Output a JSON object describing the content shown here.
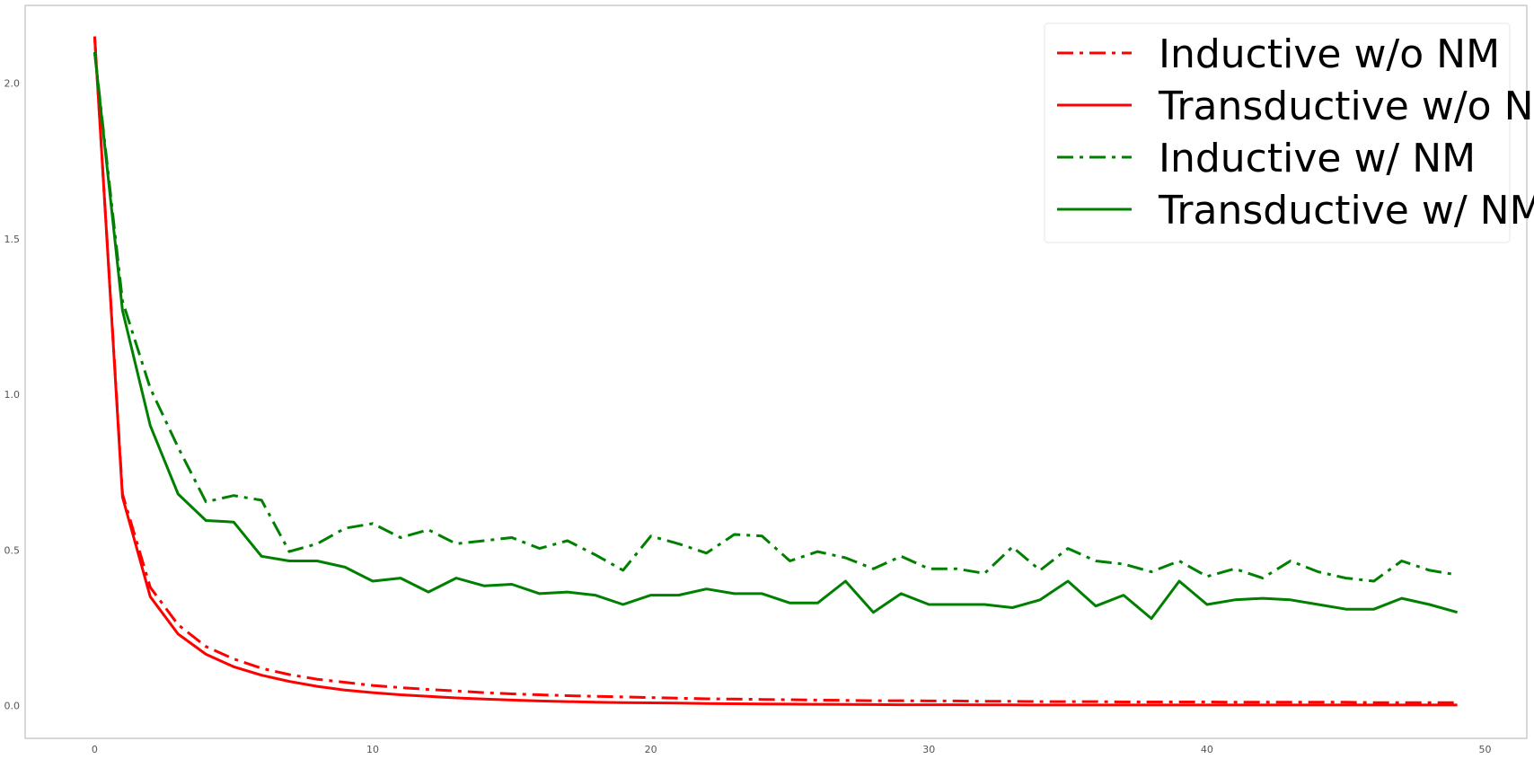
{
  "chart_data": {
    "type": "line",
    "title": "",
    "xlabel": "",
    "ylabel": "",
    "xlim": [
      -2.5,
      51.5
    ],
    "ylim": [
      -0.105,
      2.25
    ],
    "x_ticks": [
      0,
      10,
      20,
      30,
      40,
      50
    ],
    "y_ticks": [
      0.0,
      0.5,
      1.0,
      1.5,
      2.0
    ],
    "x_tick_labels": [
      "0",
      "10",
      "20",
      "30",
      "40",
      "50"
    ],
    "y_tick_labels": [
      "0.0",
      "0.5",
      "1.0",
      "1.5",
      "2.0"
    ],
    "grid": false,
    "legend_position": "top-right",
    "x": [
      0,
      1,
      2,
      3,
      4,
      5,
      6,
      7,
      8,
      9,
      10,
      11,
      12,
      13,
      14,
      15,
      16,
      17,
      18,
      19,
      20,
      21,
      22,
      23,
      24,
      25,
      26,
      27,
      28,
      29,
      30,
      31,
      32,
      33,
      34,
      35,
      36,
      37,
      38,
      39,
      40,
      41,
      42,
      43,
      44,
      45,
      46,
      47,
      48,
      49
    ],
    "series": [
      {
        "name": "Inductive w/o NM",
        "color": "#ff0000",
        "style": "dashdot",
        "values": [
          2.15,
          0.68,
          0.38,
          0.26,
          0.19,
          0.15,
          0.12,
          0.1,
          0.085,
          0.075,
          0.065,
          0.058,
          0.052,
          0.047,
          0.042,
          0.038,
          0.035,
          0.032,
          0.03,
          0.028,
          0.026,
          0.024,
          0.022,
          0.021,
          0.02,
          0.019,
          0.018,
          0.017,
          0.016,
          0.016,
          0.015,
          0.015,
          0.014,
          0.014,
          0.013,
          0.013,
          0.013,
          0.012,
          0.012,
          0.012,
          0.012,
          0.011,
          0.011,
          0.011,
          0.011,
          0.011,
          0.01,
          0.01,
          0.01,
          0.01
        ]
      },
      {
        "name": "Transductive w/o NM",
        "color": "#ff0000",
        "style": "solid",
        "values": [
          2.15,
          0.67,
          0.35,
          0.23,
          0.165,
          0.125,
          0.098,
          0.078,
          0.062,
          0.05,
          0.042,
          0.035,
          0.03,
          0.025,
          0.021,
          0.018,
          0.015,
          0.013,
          0.011,
          0.01,
          0.009,
          0.008,
          0.007,
          0.006,
          0.0055,
          0.005,
          0.0045,
          0.004,
          0.0035,
          0.003,
          0.003,
          0.003,
          0.0025,
          0.0025,
          0.002,
          0.002,
          0.002,
          0.002,
          0.002,
          0.002,
          0.002,
          0.002,
          0.002,
          0.002,
          0.002,
          0.002,
          0.002,
          0.002,
          0.002,
          0.002
        ]
      },
      {
        "name": "Inductive w/ NM",
        "color": "#008000",
        "style": "dashdot",
        "values": [
          2.1,
          1.3,
          1.02,
          0.83,
          0.655,
          0.675,
          0.66,
          0.495,
          0.52,
          0.57,
          0.585,
          0.54,
          0.565,
          0.52,
          0.53,
          0.54,
          0.505,
          0.53,
          0.485,
          0.435,
          0.545,
          0.52,
          0.49,
          0.55,
          0.545,
          0.465,
          0.495,
          0.475,
          0.44,
          0.48,
          0.44,
          0.44,
          0.425,
          0.51,
          0.435,
          0.505,
          0.465,
          0.455,
          0.43,
          0.465,
          0.415,
          0.44,
          0.41,
          0.465,
          0.43,
          0.41,
          0.4,
          0.465,
          0.435,
          0.42
        ]
      },
      {
        "name": "Transductive w/ NM",
        "color": "#008000",
        "style": "solid",
        "values": [
          2.1,
          1.27,
          0.9,
          0.68,
          0.595,
          0.59,
          0.48,
          0.465,
          0.465,
          0.445,
          0.4,
          0.41,
          0.365,
          0.41,
          0.385,
          0.39,
          0.36,
          0.365,
          0.355,
          0.325,
          0.355,
          0.355,
          0.375,
          0.36,
          0.36,
          0.33,
          0.33,
          0.4,
          0.3,
          0.36,
          0.325,
          0.325,
          0.325,
          0.315,
          0.34,
          0.4,
          0.32,
          0.355,
          0.28,
          0.4,
          0.325,
          0.34,
          0.345,
          0.34,
          0.325,
          0.31,
          0.31,
          0.345,
          0.325,
          0.3
        ]
      }
    ]
  }
}
